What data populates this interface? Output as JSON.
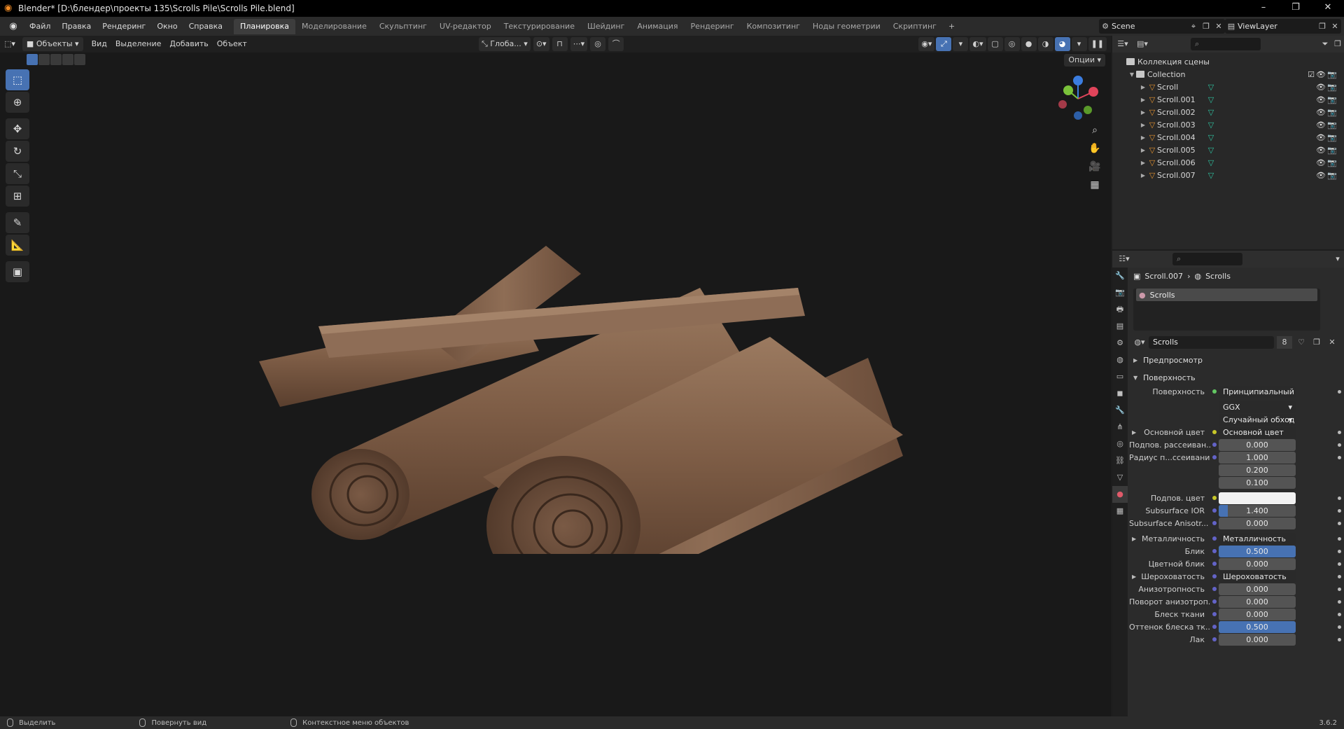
{
  "titlebar": {
    "title": "Blender* [D:\\блендер\\проекты 135\\Scrolls Pile\\Scrolls Pile.blend]",
    "minimize": "–",
    "restore": "❐",
    "close": "✕"
  },
  "menu": [
    "Файл",
    "Правка",
    "Рендеринг",
    "Окно",
    "Справка"
  ],
  "workspaces": [
    "Планировка",
    "Моделирование",
    "Скульптинг",
    "UV-редактор",
    "Текстурирование",
    "Шейдинг",
    "Анимация",
    "Рендеринг",
    "Композитинг",
    "Ноды геометрии",
    "Скриптинг"
  ],
  "workspace_add": "+",
  "scene": "Scene",
  "view_layer": "ViewLayer",
  "viewport": {
    "mode": "Объекты",
    "menus": [
      "Вид",
      "Выделение",
      "Добавить",
      "Объект"
    ],
    "orientation": "Глоба...",
    "options": "Опции"
  },
  "outliner": {
    "root": "Коллекция сцены",
    "collection": "Collection",
    "items": [
      "Scroll",
      "Scroll.001",
      "Scroll.002",
      "Scroll.003",
      "Scroll.004",
      "Scroll.005",
      "Scroll.006",
      "Scroll.007"
    ]
  },
  "properties": {
    "breadcrumb_object": "Scroll.007",
    "breadcrumb_material": "Scrolls",
    "slot_name": "Scrolls",
    "material_name": "Scrolls",
    "users": "8",
    "panel_preview": "Предпросмотр",
    "panel_surface": "Поверхность",
    "rows": [
      {
        "label": "Поверхность",
        "kind": "link",
        "value": "Принципиальный BSDF",
        "dot": "green"
      },
      {
        "label": "",
        "kind": "dd",
        "value": "GGX"
      },
      {
        "label": "",
        "kind": "dd",
        "value": "Случайный обход"
      },
      {
        "label": "Основной цвет",
        "kind": "link",
        "value": "Основной цвет",
        "dot": "yellow",
        "expand": true
      },
      {
        "label": "Подпов. рассеиван...",
        "kind": "num",
        "value": "0.000",
        "dot": "gray"
      },
      {
        "label": "Радиус п...ссеивания",
        "kind": "num",
        "value": "1.000",
        "dot": "blue"
      },
      {
        "label": "",
        "kind": "num",
        "value": "0.200"
      },
      {
        "label": "",
        "kind": "num",
        "value": "0.100"
      },
      {
        "label": "Подпов. цвет",
        "kind": "color",
        "value": "",
        "dot": "yellow"
      },
      {
        "label": "Subsurface IOR",
        "kind": "num",
        "value": "1.400",
        "dot": "gray",
        "fill": 0.12
      },
      {
        "label": "Subsurface Anisotr...",
        "kind": "num",
        "value": "0.000",
        "dot": "gray"
      },
      {
        "label": "Металличность",
        "kind": "link",
        "value": "Металличность",
        "dot": "gray",
        "expand": true
      },
      {
        "label": "Блик",
        "kind": "num",
        "value": "0.500",
        "dot": "gray",
        "fill": 1.0
      },
      {
        "label": "Цветной блик",
        "kind": "num",
        "value": "0.000",
        "dot": "gray"
      },
      {
        "label": "Шероховатость",
        "kind": "link",
        "value": "Шероховатость",
        "dot": "gray",
        "expand": true
      },
      {
        "label": "Анизотропность",
        "kind": "num",
        "value": "0.000",
        "dot": "gray"
      },
      {
        "label": "Поворот анизотроп...",
        "kind": "num",
        "value": "0.000",
        "dot": "gray"
      },
      {
        "label": "Блеск ткани",
        "kind": "num",
        "value": "0.000",
        "dot": "gray"
      },
      {
        "label": "Оттенок блеска тк...",
        "kind": "num",
        "value": "0.500",
        "dot": "gray",
        "fill": 1.0
      },
      {
        "label": "Лак",
        "kind": "num",
        "value": "0.000",
        "dot": "gray"
      }
    ]
  },
  "statusbar": {
    "hint_select": "Выделить",
    "hint_rotate": "Повернуть вид",
    "hint_context": "Контекстное меню объектов",
    "version": "3.6.2"
  },
  "colors": {
    "accent": "#4772b3",
    "object_orange": "#e3922f",
    "mesh_teal": "#2fc2a0",
    "paper": "#8a6a52"
  }
}
